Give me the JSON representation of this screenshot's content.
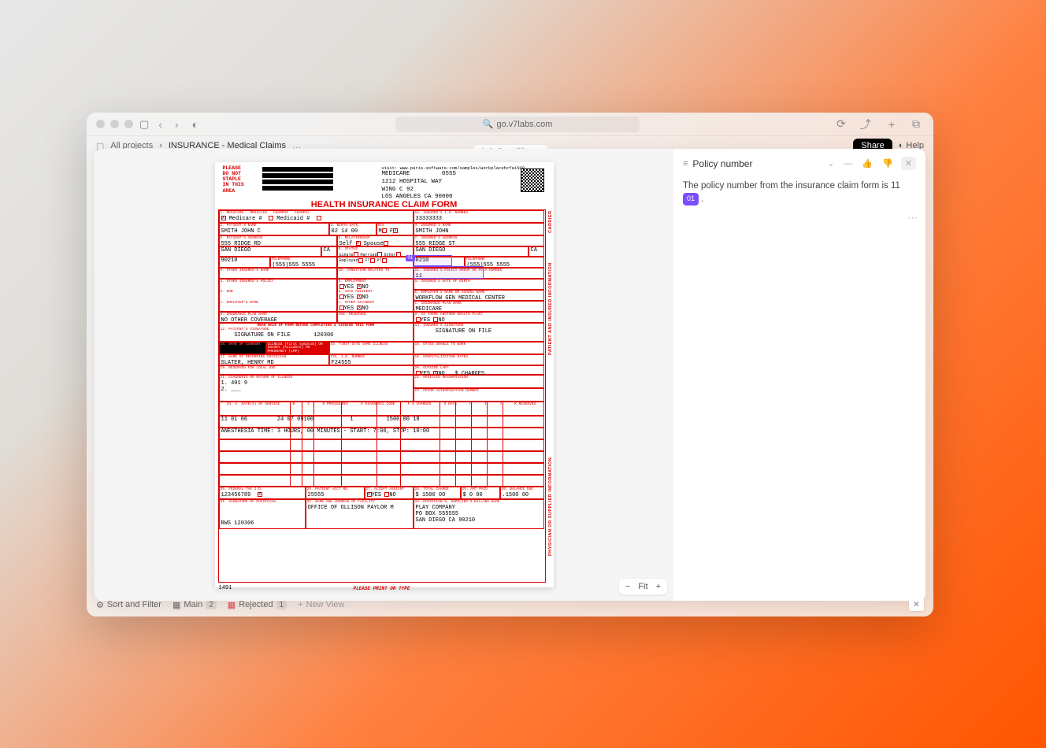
{
  "browser": {
    "url": "go.v7labs.com"
  },
  "breadcrumb": {
    "root": "All projects",
    "current": "INSURANCE - Medical Claims",
    "share": "Share",
    "help": "Help"
  },
  "central_tab": {
    "label": "Ask Go"
  },
  "panel": {
    "title": "Policy number",
    "body_prefix": "The policy number from the insurance claim form is 11",
    "badge": "01",
    "body_suffix": "."
  },
  "zoom": {
    "fit": "Fit"
  },
  "bottom_tabs": {
    "sort": "Sort and Filter",
    "main": "Main",
    "main_count": "2",
    "rejected": "Rejected",
    "rejected_count": "1",
    "new_view": "New View"
  },
  "form": {
    "header_url": "visit: www.paris-software.com/samples/workplacehcfa1500",
    "staple": [
      "PLEASE",
      "DO NOT",
      "STAPLE",
      "IN THIS",
      "AREA"
    ],
    "carrier": "MEDICARE",
    "carrier_num": "0555",
    "addr1": "1212 HOSPITAL WAY",
    "addr2": "WING C 92",
    "city_state": "LOS ANGELES    CA 90000",
    "title": "HEALTH INSURANCE CLAIM FORM",
    "insured_id": "33333333",
    "patient_name": "SMITH         JOHN            C",
    "dob": "02 14 00",
    "insured_name": "SMITH         JOHN",
    "patient_addr": "555 RIDGE RD",
    "insured_addr": "555 RIDGE ST",
    "patient_city": "SAN DIEGO",
    "patient_state": "CA",
    "insured_city": "SAN DIEGO",
    "insured_state": "CA",
    "patient_zip": "90210",
    "patient_phone": "(555)555 5555",
    "insured_zip": "0210",
    "insured_phone": "(555)555 5555",
    "policy_group": "11",
    "employer": "WORKFLOW GEN MEDICAL CENTER",
    "ins_plan": "MEDICARE",
    "other_coverage": "NO OTHER COVERAGE",
    "signback": "READ BACK OF FORM BEFORE COMPLETING & SIGNING THIS FORM",
    "sig1": "SIGNATURE ON FILE",
    "sig1_date": "120306",
    "sig2": "SIGNATURE ON FILE",
    "ref_phys": "SLATER, HENRY MD",
    "ref_phys_id": "F24555",
    "diag": "401 9",
    "svc_date": "11 01 06",
    "svc_proc": "24 07  09100",
    "svc_units": "1",
    "svc_charge": "1500 00 18",
    "anesthesia": "ANESTHESIA TIME:  3 HOURS,  00 MINUTES -   START: 7:00, STOP: 10:00",
    "tax_id": "123456789",
    "acct_no": "25555",
    "total_charge": "1500 00",
    "amt_paid": "0 00",
    "balance": ".1500 00",
    "facility": "OFFICE OF OLLISON PAYLOR M",
    "billing_name": "PLAY COMPANY",
    "billing_addr": "PO BOX 555555",
    "billing_city": "SAN DIEGO      CA 90210",
    "sign_supplier": "RWS    120306",
    "form_no": "1491",
    "footer": "PLEASE PRINT OR TYPE",
    "side_label1": "PATIENT AND INSURED INFORMATION",
    "side_label2": "PHYSICIAN OR SUPPLIER INFORMATION",
    "side_label3": "CARRIER"
  }
}
